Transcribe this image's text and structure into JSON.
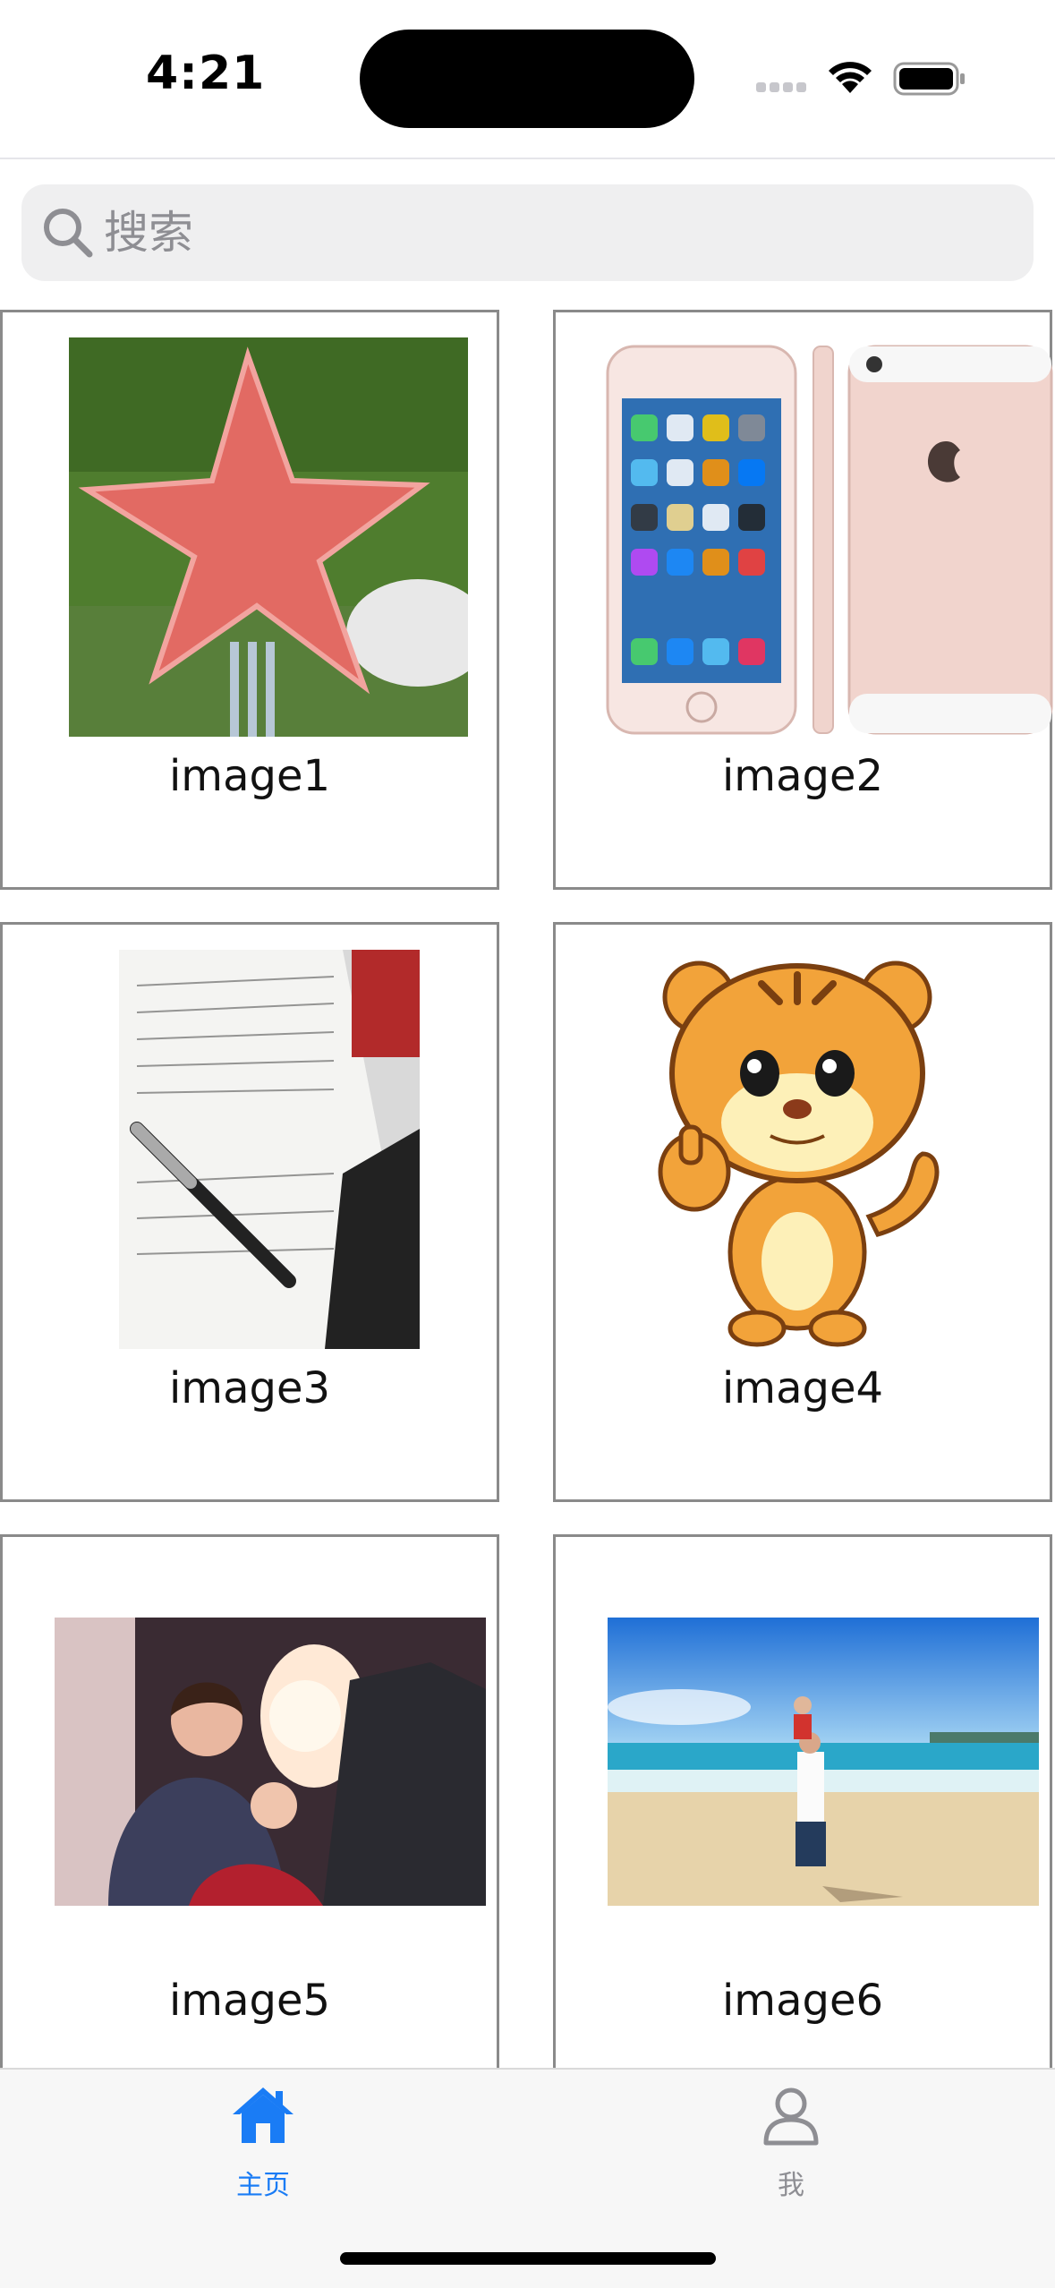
{
  "status_bar": {
    "time": "4:21"
  },
  "search": {
    "placeholder": "搜索"
  },
  "grid": {
    "items": [
      {
        "label": "image1",
        "image": "red star-shaped watermelon slice on fork"
      },
      {
        "label": "image2",
        "image": "rose gold iPhone front, side and back"
      },
      {
        "label": "image3",
        "image": "handwritten notebook with pen"
      },
      {
        "label": "image4",
        "image": "cartoon tiger giving thumbs up"
      },
      {
        "label": "image5",
        "image": "woman holding baby by airplane window"
      },
      {
        "label": "image6",
        "image": "man lifting child on beach"
      }
    ]
  },
  "tabbar": {
    "home": {
      "label": "主页",
      "icon": "house-icon",
      "active": true
    },
    "me": {
      "label": "我",
      "icon": "person-icon",
      "active": false
    }
  },
  "colors": {
    "accent": "#1a7cf5",
    "inactive": "#8e8e93",
    "border": "#8a8a8a"
  }
}
